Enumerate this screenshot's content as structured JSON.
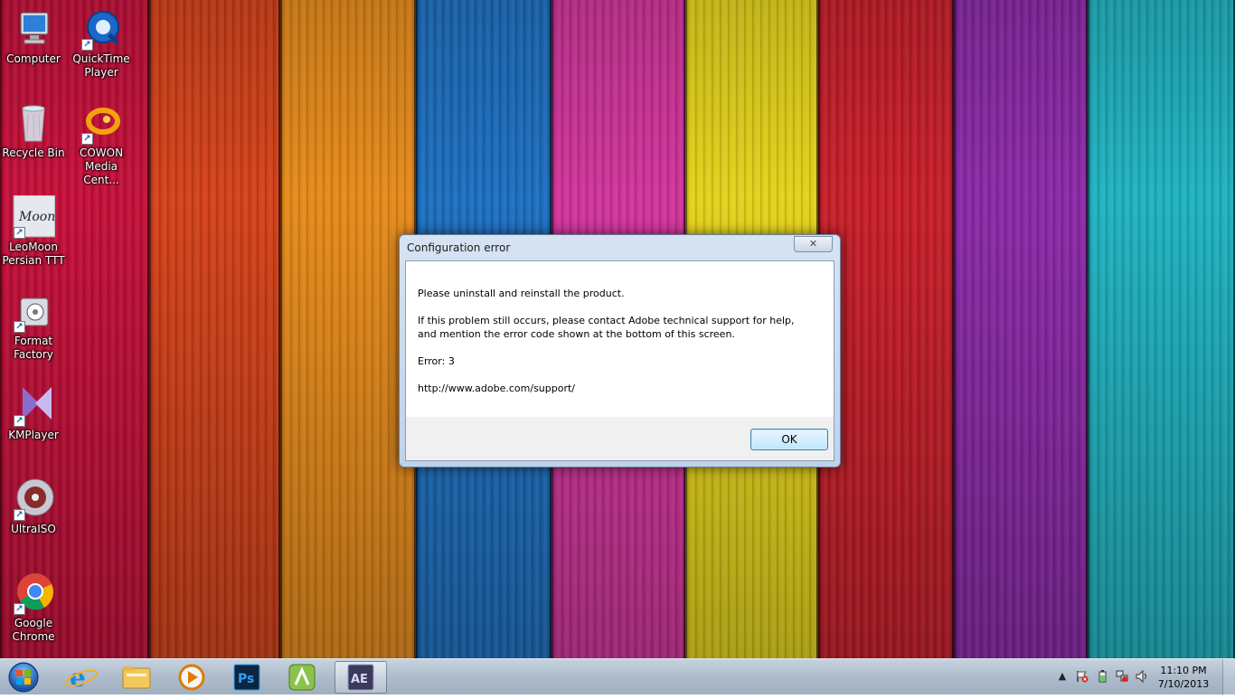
{
  "desktop": {
    "icons": [
      {
        "id": "computer",
        "label": "Computer",
        "icon": "computer-icon"
      },
      {
        "id": "quicktime",
        "label": "QuickTime Player",
        "icon": "quicktime-icon"
      },
      {
        "id": "recycle",
        "label": "Recycle Bin",
        "icon": "recycle-bin-icon"
      },
      {
        "id": "cowon",
        "label": "COWON Media Cent...",
        "icon": "cowon-icon"
      },
      {
        "id": "leomoon",
        "label": "LeoMoon Persian TTT",
        "icon": "leomoon-icon"
      },
      {
        "id": "format",
        "label": "Format Factory",
        "icon": "format-factory-icon"
      },
      {
        "id": "kmplayer",
        "label": "KMPlayer",
        "icon": "kmplayer-icon"
      },
      {
        "id": "ultraiso",
        "label": "UltraISO",
        "icon": "ultraiso-icon"
      },
      {
        "id": "chrome",
        "label": "Google Chrome",
        "icon": "chrome-icon"
      }
    ]
  },
  "dialog": {
    "title": "Configuration error",
    "close_glyph": "✕",
    "line1": "Please uninstall and reinstall the product.",
    "line2": "If this problem still occurs, please contact Adobe technical support for help, and mention the error code shown at the bottom of this screen.",
    "line3": "Error: 3",
    "line4": "http://www.adobe.com/support/",
    "ok_label": "OK"
  },
  "taskbar": {
    "items": [
      {
        "name": "internet-explorer",
        "icon": "ie-icon"
      },
      {
        "name": "windows-explorer",
        "icon": "folder-icon"
      },
      {
        "name": "media-player",
        "icon": "media-player-icon"
      },
      {
        "name": "photoshop",
        "icon": "photoshop-icon",
        "text": "Ps"
      },
      {
        "name": "app-green",
        "icon": "green-app-icon"
      },
      {
        "name": "after-effects",
        "icon": "after-effects-icon",
        "text": "AE"
      }
    ],
    "clock": {
      "time": "11:10 PM",
      "date": "7/10/2013"
    }
  }
}
